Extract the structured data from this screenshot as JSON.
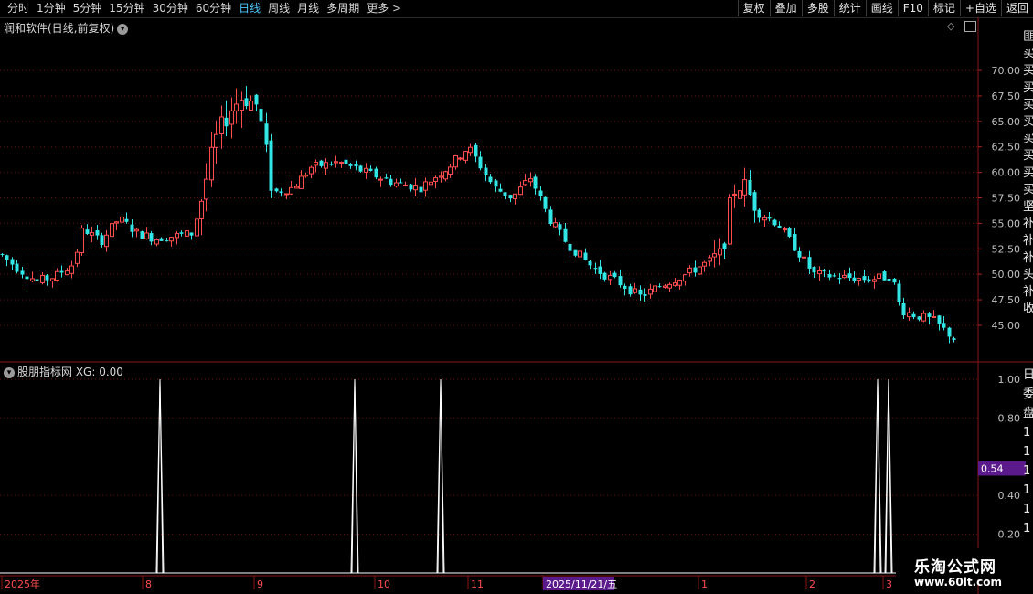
{
  "toolbar": {
    "tabs": [
      "分时",
      "1分钟",
      "5分钟",
      "15分钟",
      "30分钟",
      "60分钟",
      "日线",
      "周线",
      "月线",
      "多周期",
      "更多 >"
    ],
    "active_tab": "日线",
    "right_buttons": [
      "复权",
      "叠加",
      "多股",
      "统计",
      "画线",
      "F10",
      "标记",
      "+自选",
      "返回"
    ]
  },
  "main_panel": {
    "title": "润和软件(日线,前复权)",
    "y_ticks": [
      "70.00",
      "67.50",
      "65.00",
      "62.50",
      "60.00",
      "57.50",
      "55.00",
      "52.50",
      "50.00",
      "47.50",
      "45.00"
    ]
  },
  "indicator_panel": {
    "title": "股朋指标网 XG: 0.00",
    "y_ticks": [
      "1.00",
      "0.80",
      "0.54",
      "0.40",
      "0.20"
    ],
    "current_value": "0.54"
  },
  "x_axis": {
    "labels": [
      "2025年",
      "8",
      "9",
      "10",
      "11",
      "2025/11/21/五",
      "1",
      "2",
      "3"
    ]
  },
  "right_strip": {
    "glyphs": [
      "匪",
      "买",
      "买",
      "买",
      "买",
      "买",
      "买",
      "买",
      "买",
      "买",
      "坚",
      "补",
      "补",
      "补",
      "头",
      "补",
      "收"
    ],
    "lower_glyphs": [
      "日",
      "委",
      "盘",
      "1",
      "1",
      "1",
      "1",
      "1",
      "1"
    ]
  },
  "watermark": {
    "title": "乐淘公式网",
    "url": "www.60lt.com"
  },
  "colors": {
    "up": "#ff4d4d",
    "down": "#33e6e6",
    "axis": "#c0c0c0",
    "grid": "#6a1010",
    "tab_active": "#4ec9ff",
    "highlight": "#5a1a8c"
  },
  "chart_data": {
    "type": "candlestick",
    "ylim": [
      41.5,
      73.5
    ],
    "signal_series": {
      "name": "XG",
      "ylim": [
        0,
        1.08
      ]
    }
  }
}
